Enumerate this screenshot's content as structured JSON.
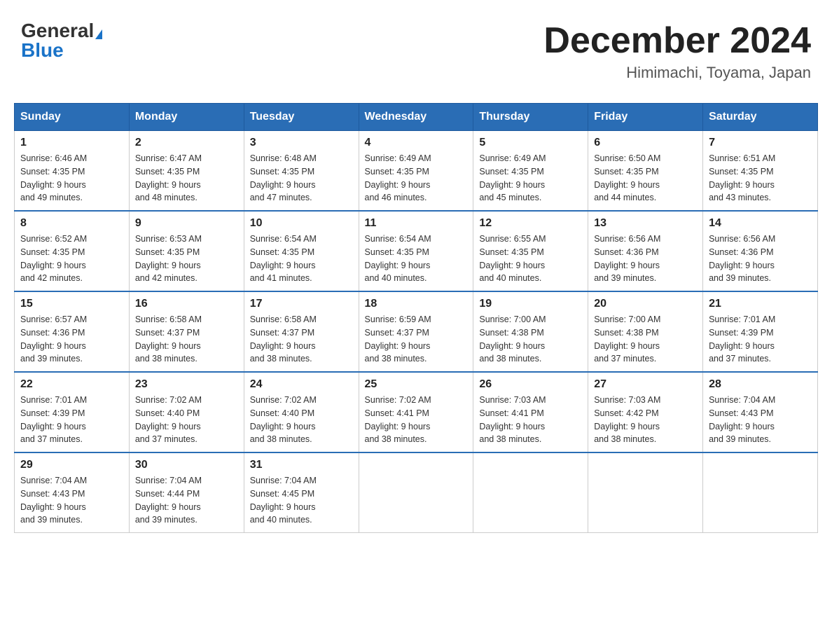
{
  "header": {
    "logo_general": "General",
    "logo_blue": "Blue",
    "month_title": "December 2024",
    "location": "Himimachi, Toyama, Japan"
  },
  "weekdays": [
    "Sunday",
    "Monday",
    "Tuesday",
    "Wednesday",
    "Thursday",
    "Friday",
    "Saturday"
  ],
  "weeks": [
    [
      {
        "day": "1",
        "sunrise": "6:46 AM",
        "sunset": "4:35 PM",
        "daylight": "9 hours and 49 minutes."
      },
      {
        "day": "2",
        "sunrise": "6:47 AM",
        "sunset": "4:35 PM",
        "daylight": "9 hours and 48 minutes."
      },
      {
        "day": "3",
        "sunrise": "6:48 AM",
        "sunset": "4:35 PM",
        "daylight": "9 hours and 47 minutes."
      },
      {
        "day": "4",
        "sunrise": "6:49 AM",
        "sunset": "4:35 PM",
        "daylight": "9 hours and 46 minutes."
      },
      {
        "day": "5",
        "sunrise": "6:49 AM",
        "sunset": "4:35 PM",
        "daylight": "9 hours and 45 minutes."
      },
      {
        "day": "6",
        "sunrise": "6:50 AM",
        "sunset": "4:35 PM",
        "daylight": "9 hours and 44 minutes."
      },
      {
        "day": "7",
        "sunrise": "6:51 AM",
        "sunset": "4:35 PM",
        "daylight": "9 hours and 43 minutes."
      }
    ],
    [
      {
        "day": "8",
        "sunrise": "6:52 AM",
        "sunset": "4:35 PM",
        "daylight": "9 hours and 42 minutes."
      },
      {
        "day": "9",
        "sunrise": "6:53 AM",
        "sunset": "4:35 PM",
        "daylight": "9 hours and 42 minutes."
      },
      {
        "day": "10",
        "sunrise": "6:54 AM",
        "sunset": "4:35 PM",
        "daylight": "9 hours and 41 minutes."
      },
      {
        "day": "11",
        "sunrise": "6:54 AM",
        "sunset": "4:35 PM",
        "daylight": "9 hours and 40 minutes."
      },
      {
        "day": "12",
        "sunrise": "6:55 AM",
        "sunset": "4:35 PM",
        "daylight": "9 hours and 40 minutes."
      },
      {
        "day": "13",
        "sunrise": "6:56 AM",
        "sunset": "4:36 PM",
        "daylight": "9 hours and 39 minutes."
      },
      {
        "day": "14",
        "sunrise": "6:56 AM",
        "sunset": "4:36 PM",
        "daylight": "9 hours and 39 minutes."
      }
    ],
    [
      {
        "day": "15",
        "sunrise": "6:57 AM",
        "sunset": "4:36 PM",
        "daylight": "9 hours and 39 minutes."
      },
      {
        "day": "16",
        "sunrise": "6:58 AM",
        "sunset": "4:37 PM",
        "daylight": "9 hours and 38 minutes."
      },
      {
        "day": "17",
        "sunrise": "6:58 AM",
        "sunset": "4:37 PM",
        "daylight": "9 hours and 38 minutes."
      },
      {
        "day": "18",
        "sunrise": "6:59 AM",
        "sunset": "4:37 PM",
        "daylight": "9 hours and 38 minutes."
      },
      {
        "day": "19",
        "sunrise": "7:00 AM",
        "sunset": "4:38 PM",
        "daylight": "9 hours and 38 minutes."
      },
      {
        "day": "20",
        "sunrise": "7:00 AM",
        "sunset": "4:38 PM",
        "daylight": "9 hours and 37 minutes."
      },
      {
        "day": "21",
        "sunrise": "7:01 AM",
        "sunset": "4:39 PM",
        "daylight": "9 hours and 37 minutes."
      }
    ],
    [
      {
        "day": "22",
        "sunrise": "7:01 AM",
        "sunset": "4:39 PM",
        "daylight": "9 hours and 37 minutes."
      },
      {
        "day": "23",
        "sunrise": "7:02 AM",
        "sunset": "4:40 PM",
        "daylight": "9 hours and 37 minutes."
      },
      {
        "day": "24",
        "sunrise": "7:02 AM",
        "sunset": "4:40 PM",
        "daylight": "9 hours and 38 minutes."
      },
      {
        "day": "25",
        "sunrise": "7:02 AM",
        "sunset": "4:41 PM",
        "daylight": "9 hours and 38 minutes."
      },
      {
        "day": "26",
        "sunrise": "7:03 AM",
        "sunset": "4:41 PM",
        "daylight": "9 hours and 38 minutes."
      },
      {
        "day": "27",
        "sunrise": "7:03 AM",
        "sunset": "4:42 PM",
        "daylight": "9 hours and 38 minutes."
      },
      {
        "day": "28",
        "sunrise": "7:04 AM",
        "sunset": "4:43 PM",
        "daylight": "9 hours and 39 minutes."
      }
    ],
    [
      {
        "day": "29",
        "sunrise": "7:04 AM",
        "sunset": "4:43 PM",
        "daylight": "9 hours and 39 minutes."
      },
      {
        "day": "30",
        "sunrise": "7:04 AM",
        "sunset": "4:44 PM",
        "daylight": "9 hours and 39 minutes."
      },
      {
        "day": "31",
        "sunrise": "7:04 AM",
        "sunset": "4:45 PM",
        "daylight": "9 hours and 40 minutes."
      },
      null,
      null,
      null,
      null
    ]
  ]
}
